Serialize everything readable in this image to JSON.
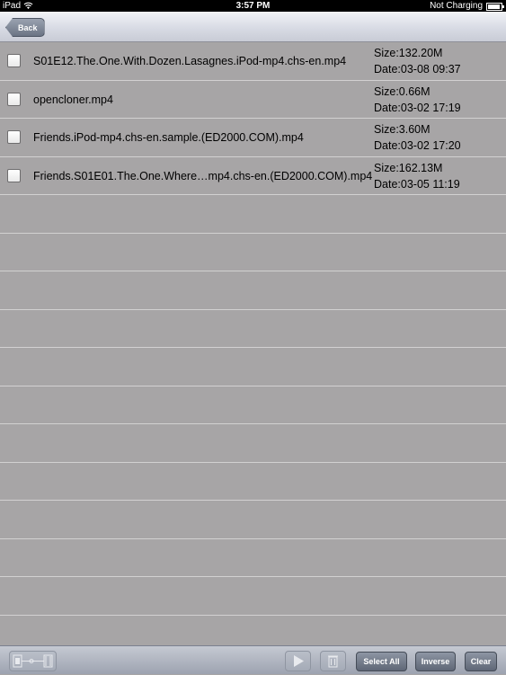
{
  "status_bar": {
    "device": "iPad",
    "time": "3:57 PM",
    "charging": "Not Charging",
    "battery_level": 0.9
  },
  "nav": {
    "back_label": "Back"
  },
  "files": [
    {
      "name": "S01E12.The.One.With.Dozen.Lasagnes.iPod-mp4.chs-en.mp4",
      "size": "Size:132.20M",
      "date": "Date:03-08 09:37",
      "checked": false
    },
    {
      "name": "opencloner.mp4",
      "size": "Size:0.66M",
      "date": "Date:03-02 17:19",
      "checked": false
    },
    {
      "name": "Friends.iPod-mp4.chs-en.sample.(ED2000.COM).mp4",
      "size": "Size:3.60M",
      "date": "Date:03-02 17:20",
      "checked": false
    },
    {
      "name": "Friends.S01E01.The.One.Where…mp4.chs-en.(ED2000.COM).mp4",
      "size": "Size:162.13M",
      "date": "Date:03-05 11:19",
      "checked": false
    }
  ],
  "toolbar": {
    "select_all_label": "Select All",
    "inverse_label": "Inverse",
    "clear_label": "Clear",
    "icons": [
      "film-transfer-icon",
      "play-icon",
      "trash-icon"
    ]
  }
}
